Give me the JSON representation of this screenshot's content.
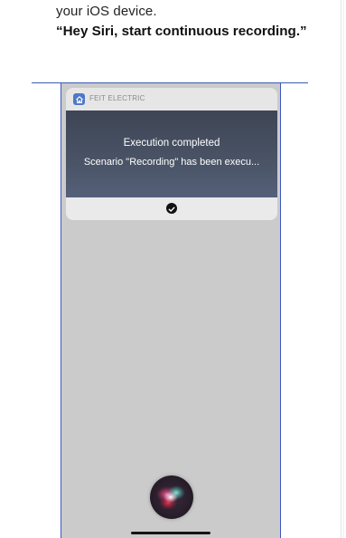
{
  "manual": {
    "line1": "your iOS device.",
    "line2": "“Hey Siri, start continuous recording.”"
  },
  "notification": {
    "app_name": "FEIT ELECTRIC",
    "app_icon": "home-icon",
    "title": "Execution completed",
    "message": "Scenario \"Recording\" has been execu...",
    "confirm_icon": "check-circle-icon"
  },
  "siri": {
    "icon": "siri-orb-icon"
  },
  "colors": {
    "callout": "#3a5ab6",
    "phone_border": "#3a55c0",
    "phone_bg": "#cbcbcb",
    "notif_body": "#4a5466",
    "app_icon": "#4f78c9"
  }
}
